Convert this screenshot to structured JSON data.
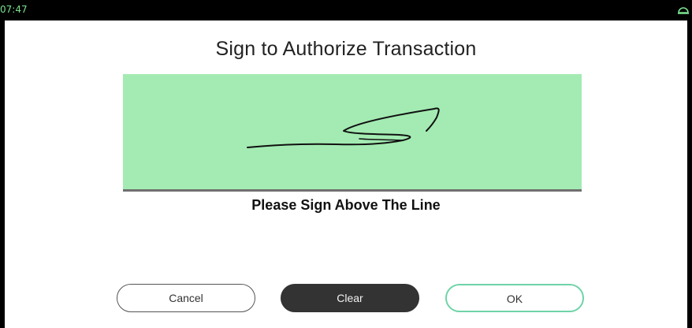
{
  "status_bar": {
    "time": "07:47",
    "icon": "cloud-icon"
  },
  "title": "Sign to Authorize Transaction",
  "signature_pad": {
    "background_color": "#a3ebb2",
    "has_signature": true
  },
  "instruction": "Please Sign Above The Line",
  "buttons": {
    "cancel": "Cancel",
    "clear": "Clear",
    "ok": "OK"
  },
  "colors": {
    "clear_button": "#333333",
    "ok_border": "#6fd3a8"
  }
}
